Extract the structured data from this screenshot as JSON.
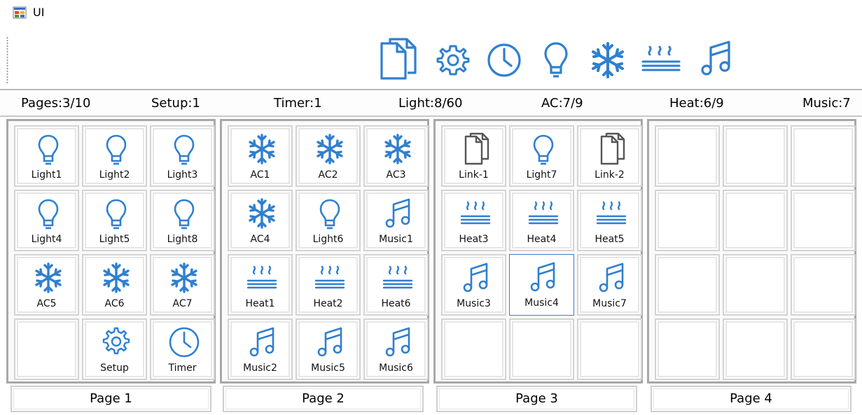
{
  "window": {
    "title": "UI"
  },
  "accent_color": "#2f7fd0",
  "toolbar": {
    "buttons": [
      {
        "name": "link-button",
        "icon": "link-pages-icon"
      },
      {
        "name": "setup-button",
        "icon": "gear-icon"
      },
      {
        "name": "timer-button",
        "icon": "clock-icon"
      },
      {
        "name": "light-button",
        "icon": "bulb-icon"
      },
      {
        "name": "ac-button",
        "icon": "snowflake-icon"
      },
      {
        "name": "heat-button",
        "icon": "heat-icon"
      },
      {
        "name": "music-button",
        "icon": "music-note-icon"
      }
    ]
  },
  "status": {
    "pages": "Pages:3/10",
    "setup": "Setup:1",
    "timer": "Timer:1",
    "light": "Light:8/60",
    "ac": "AC:7/9",
    "heat": "Heat:6/9",
    "music": "Music:7"
  },
  "pages": [
    {
      "label": "Page 1",
      "slots": [
        {
          "icon": "bulb-icon",
          "label": "Light1"
        },
        {
          "icon": "bulb-icon",
          "label": "Light2"
        },
        {
          "icon": "bulb-icon",
          "label": "Light3"
        },
        {
          "icon": "bulb-icon",
          "label": "Light4"
        },
        {
          "icon": "bulb-icon",
          "label": "Light5"
        },
        {
          "icon": "bulb-icon",
          "label": "Light8"
        },
        {
          "icon": "snowflake-icon",
          "label": "AC5"
        },
        {
          "icon": "snowflake-icon",
          "label": "AC6"
        },
        {
          "icon": "snowflake-icon",
          "label": "AC7"
        },
        {
          "icon": "",
          "label": ""
        },
        {
          "icon": "gear-icon",
          "label": "Setup"
        },
        {
          "icon": "clock-icon",
          "label": "Timer"
        }
      ]
    },
    {
      "label": "Page 2",
      "slots": [
        {
          "icon": "snowflake-icon",
          "label": "AC1"
        },
        {
          "icon": "snowflake-icon",
          "label": "AC2"
        },
        {
          "icon": "snowflake-icon",
          "label": "AC3"
        },
        {
          "icon": "snowflake-icon",
          "label": "AC4"
        },
        {
          "icon": "bulb-icon",
          "label": "Light6"
        },
        {
          "icon": "music-note-icon",
          "label": "Music1"
        },
        {
          "icon": "heat-icon",
          "label": "Heat1"
        },
        {
          "icon": "heat-icon",
          "label": "Heat2"
        },
        {
          "icon": "heat-icon",
          "label": "Heat6"
        },
        {
          "icon": "music-note-icon",
          "label": "Music2"
        },
        {
          "icon": "music-note-icon",
          "label": "Music5"
        },
        {
          "icon": "music-note-icon",
          "label": "Music6"
        }
      ]
    },
    {
      "label": "Page 3",
      "slots": [
        {
          "icon": "link-pages-icon",
          "label": "Link-1"
        },
        {
          "icon": "bulb-icon",
          "label": "Light7"
        },
        {
          "icon": "link-pages-icon",
          "label": "Link-2"
        },
        {
          "icon": "heat-icon",
          "label": "Heat3"
        },
        {
          "icon": "heat-icon",
          "label": "Heat4"
        },
        {
          "icon": "heat-icon",
          "label": "Heat5"
        },
        {
          "icon": "music-note-icon",
          "label": "Music3"
        },
        {
          "icon": "music-note-icon",
          "label": "Music4",
          "selected": true
        },
        {
          "icon": "music-note-icon",
          "label": "Music7"
        },
        {
          "icon": "",
          "label": ""
        },
        {
          "icon": "",
          "label": ""
        },
        {
          "icon": "",
          "label": ""
        }
      ]
    },
    {
      "label": "Page 4",
      "slots": [
        {
          "icon": "",
          "label": ""
        },
        {
          "icon": "",
          "label": ""
        },
        {
          "icon": "",
          "label": ""
        },
        {
          "icon": "",
          "label": ""
        },
        {
          "icon": "",
          "label": ""
        },
        {
          "icon": "",
          "label": ""
        },
        {
          "icon": "",
          "label": ""
        },
        {
          "icon": "",
          "label": ""
        },
        {
          "icon": "",
          "label": ""
        },
        {
          "icon": "",
          "label": ""
        },
        {
          "icon": "",
          "label": ""
        },
        {
          "icon": "",
          "label": ""
        }
      ]
    }
  ]
}
